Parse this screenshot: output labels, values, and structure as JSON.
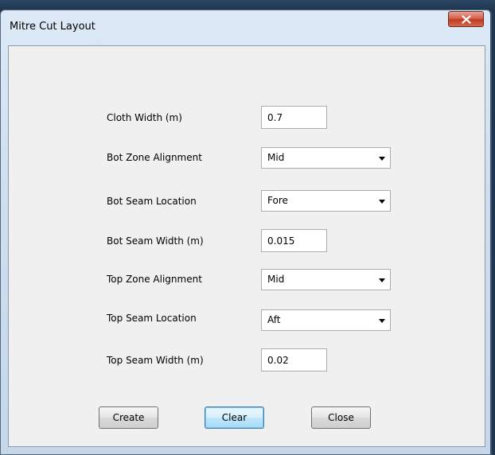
{
  "window": {
    "title": "Mitre Cut Layout"
  },
  "form": {
    "cloth_width": {
      "label": "Cloth Width (m)",
      "value": "0.7"
    },
    "bot_zone_alignment": {
      "label": "Bot Zone Alignment",
      "value": "Mid"
    },
    "bot_seam_location": {
      "label": "Bot Seam Location",
      "value": "Fore"
    },
    "bot_seam_width": {
      "label": "Bot Seam Width (m)",
      "value": "0.015"
    },
    "top_zone_alignment": {
      "label": "Top Zone Alignment",
      "value": "Mid"
    },
    "top_seam_location": {
      "label": "Top Seam Location",
      "value": "Aft"
    },
    "top_seam_width": {
      "label": "Top Seam Width (m)",
      "value": "0.02"
    }
  },
  "buttons": {
    "create": "Create",
    "clear": "Clear",
    "close": "Close"
  },
  "icons": {
    "title_close": "close-x-icon",
    "combo_arrow": "chevron-down-icon"
  },
  "colors": {
    "close_button": "#c7422a",
    "window_frame": "#cfdff0",
    "client_background": "#f0f0f0"
  }
}
